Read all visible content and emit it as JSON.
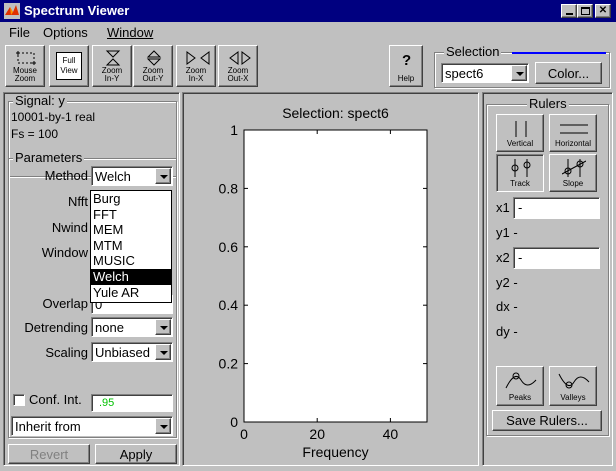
{
  "window": {
    "title": "Spectrum Viewer"
  },
  "menu": [
    "File",
    "Options",
    "Window"
  ],
  "toolbar": {
    "mouse_zoom": [
      "Mouse",
      "Zoom"
    ],
    "full_view": [
      "Full",
      "View"
    ],
    "zoom_in_y": [
      "Zoom",
      "In-Y"
    ],
    "zoom_out_y": [
      "Zoom",
      "Out-Y"
    ],
    "zoom_in_x": [
      "Zoom",
      "In-X"
    ],
    "zoom_out_x": [
      "Zoom",
      "Out-X"
    ],
    "help_symbol": "?",
    "help_label": "Help"
  },
  "selection": {
    "label": "Selection",
    "value": "spect6",
    "color_button": "Color...",
    "line_color": "#0000ff"
  },
  "signal": {
    "label": "Signal: y",
    "line1": "10001-by-1 real",
    "line2": "Fs = 100"
  },
  "parameters": {
    "label": "Parameters",
    "method_label": "Method",
    "method_value": "Welch",
    "nfft_label": "Nfft",
    "nwind_label": "Nwind",
    "window_label": "Window",
    "overlap_label": "Overlap",
    "overlap_value": "0",
    "detrending_label": "Detrending",
    "detrending_value": "none",
    "scaling_label": "Scaling",
    "scaling_value": "Unbiased",
    "method_options": [
      "Burg",
      "FFT",
      "MEM",
      "MTM",
      "MUSIC",
      "Welch",
      "Yule AR"
    ],
    "selected_option": "Welch",
    "conf_label": "Conf. Int.",
    "conf_value": ".95",
    "conf_color": "#00c000",
    "inherit_value": "Inherit from",
    "revert_button": "Revert",
    "apply_button": "Apply"
  },
  "chart_data": {
    "type": "line",
    "title": "Selection: spect6",
    "xlabel": "Frequency",
    "ylabel": "",
    "xlim": [
      0,
      50
    ],
    "ylim": [
      0,
      1
    ],
    "x_ticks": [
      0,
      20,
      40
    ],
    "y_ticks": [
      0,
      0.2,
      0.4,
      0.6,
      0.8,
      1
    ],
    "x_tick_labels": [
      "0",
      "20",
      "40"
    ],
    "y_tick_labels": [
      "0",
      "0.2",
      "0.4",
      "0.6",
      "0.8",
      "1"
    ],
    "series": []
  },
  "rulers": {
    "label": "Rulers",
    "vertical": "Vertical",
    "horizontal": "Horizontal",
    "track": "Track",
    "slope": "Slope",
    "x1_label": "x1",
    "x1_value": "-",
    "y1_label": "y1",
    "y1_value": "-",
    "x2_label": "x2",
    "x2_value": "-",
    "y2_label": "y2",
    "y2_value": "-",
    "dx_label": "dx",
    "dx_value": "-",
    "dy_label": "dy",
    "dy_value": "-",
    "peaks": "Peaks",
    "valleys": "Valleys",
    "save_button": "Save Rulers..."
  }
}
